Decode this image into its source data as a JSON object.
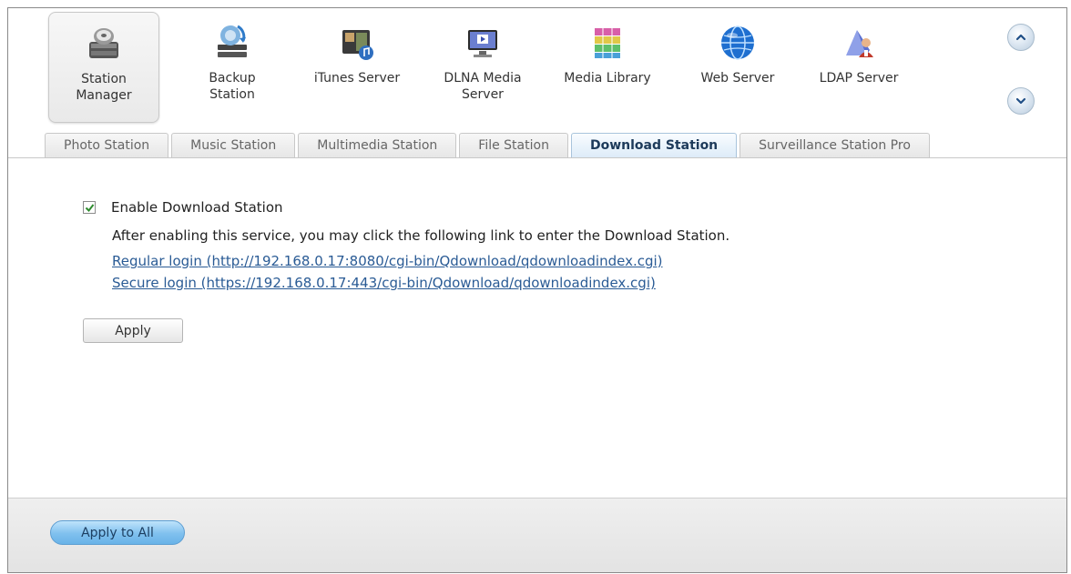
{
  "apps": [
    {
      "label": "Station\nManager",
      "icon": "station-manager-icon",
      "selected": true
    },
    {
      "label": "Backup\nStation",
      "icon": "backup-station-icon",
      "selected": false
    },
    {
      "label": "iTunes Server",
      "icon": "itunes-server-icon",
      "selected": false
    },
    {
      "label": "DLNA Media\nServer",
      "icon": "dlna-media-server-icon",
      "selected": false
    },
    {
      "label": "Media Library",
      "icon": "media-library-icon",
      "selected": false
    },
    {
      "label": "Web Server",
      "icon": "web-server-icon",
      "selected": false
    },
    {
      "label": "LDAP Server",
      "icon": "ldap-server-icon",
      "selected": false
    }
  ],
  "tabs": [
    {
      "label": "Photo Station",
      "active": false
    },
    {
      "label": "Music Station",
      "active": false
    },
    {
      "label": "Multimedia Station",
      "active": false
    },
    {
      "label": "File Station",
      "active": false
    },
    {
      "label": "Download Station",
      "active": true
    },
    {
      "label": "Surveillance Station Pro",
      "active": false
    }
  ],
  "content": {
    "enable_label": "Enable Download Station",
    "enable_checked": true,
    "info_text": "After enabling this service, you may click the following link to enter the Download Station.",
    "regular_login": "Regular login (http://192.168.0.17:8080/cgi-bin/Qdownload/qdownloadindex.cgi)",
    "secure_login": "Secure login (https://192.168.0.17:443/cgi-bin/Qdownload/qdownloadindex.cgi)",
    "apply_label": "Apply"
  },
  "footer": {
    "apply_all_label": "Apply to All"
  },
  "colors": {
    "link": "#2a5b95",
    "active_tab_text": "#1d3a5a",
    "apply_all_bg": "#7fc0ee"
  }
}
